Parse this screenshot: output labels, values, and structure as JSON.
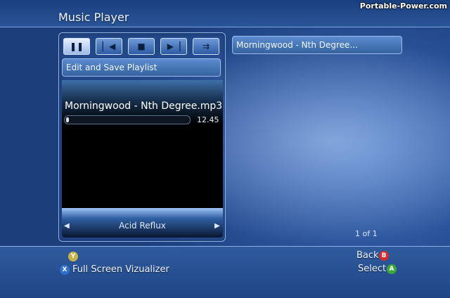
{
  "app": {
    "title": "Music Player",
    "watermark": "Portable-Power.com"
  },
  "transport": {
    "buttons": [
      {
        "id": "pause",
        "icon": "pause-icon",
        "glyph": "❚❚"
      },
      {
        "id": "previous",
        "icon": "skip-back-icon",
        "glyph": "▏◀"
      },
      {
        "id": "stop",
        "icon": "stop-icon",
        "glyph": "■"
      },
      {
        "id": "next",
        "icon": "skip-forward-icon",
        "glyph": "▶▕"
      },
      {
        "id": "repeat",
        "icon": "repeat-icon",
        "glyph": "⇉"
      }
    ]
  },
  "playlist": {
    "edit_label": "Edit and Save Playlist"
  },
  "now_playing": {
    "track": "Morningwood - Nth Degree.mp3",
    "time": "12.45",
    "progress_fraction": 0.02
  },
  "visualizer": {
    "name": "Acid Reflux",
    "left_arrow": "◀",
    "right_arrow": "▶"
  },
  "queue": {
    "current": "Morningwood - Nth Degree...",
    "page": "1 of 1"
  },
  "hints": {
    "y_label": "Y",
    "x_label": "X",
    "fullscreen": "Full Screen Vizualizer",
    "back": "Back",
    "b_label": "B",
    "select": "Select",
    "a_label": "A"
  },
  "colors": {
    "accent_blue": "#2a5298",
    "y_button": "#c8b24a",
    "x_button": "#2f6fd1",
    "b_button": "#d12d2d",
    "a_button": "#3ca83c"
  }
}
